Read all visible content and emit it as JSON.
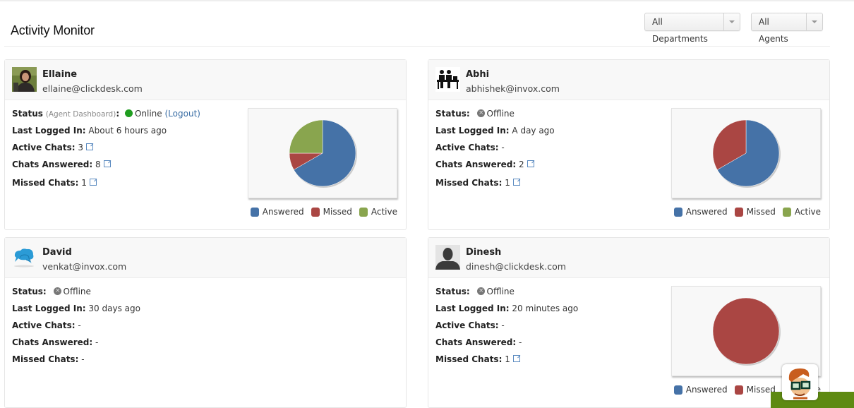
{
  "page": {
    "title": "Activity Monitor"
  },
  "filters": {
    "department": {
      "selected": "All Departments"
    },
    "agent": {
      "selected": "All Agents"
    }
  },
  "labels": {
    "status": "Status",
    "status_sub": "(Agent Dashboard)",
    "colon": ":",
    "last_logged_in": "Last Logged In:",
    "active_chats": "Active Chats:",
    "chats_answered": "Chats Answered:",
    "missed_chats": "Missed Chats:",
    "logout": "(Logout)"
  },
  "legend": [
    {
      "label": "Answered",
      "color": "#4572a7"
    },
    {
      "label": "Missed",
      "color": "#aa4643"
    },
    {
      "label": "Active",
      "color": "#89a54e"
    }
  ],
  "agents": [
    {
      "name": "Ellaine",
      "email": "ellaine@clickdesk.com",
      "avatar": "photo",
      "status": "Online",
      "online": true,
      "last_logged_in": "About 6 hours ago",
      "active_chats": "3",
      "chats_answered": "8",
      "missed_chats": "1"
    },
    {
      "name": "Abhi",
      "email": "abhishek@invox.com",
      "avatar": "people-at-desk-icon",
      "status": "Offline",
      "online": false,
      "last_logged_in": "A day ago",
      "active_chats": "-",
      "chats_answered": "2",
      "missed_chats": "1"
    },
    {
      "name": "David",
      "email": "venkat@invox.com",
      "avatar": "chat-bubbles-icon",
      "status": "Offline",
      "online": false,
      "last_logged_in": "30 days ago",
      "active_chats": "-",
      "chats_answered": "-",
      "missed_chats": "-"
    },
    {
      "name": "Dinesh",
      "email": "dinesh@clickdesk.com",
      "avatar": "default-user-silhouette",
      "status": "Offline",
      "online": false,
      "last_logged_in": "20 minutes ago",
      "active_chats": "-",
      "chats_answered": "-",
      "missed_chats": "1"
    }
  ],
  "chart_data": [
    {
      "type": "pie",
      "agent": "Ellaine",
      "categories": [
        "Answered",
        "Missed",
        "Active"
      ],
      "values": [
        8,
        1,
        3
      ]
    },
    {
      "type": "pie",
      "agent": "Abhi",
      "categories": [
        "Answered",
        "Missed",
        "Active"
      ],
      "values": [
        2,
        1,
        0
      ]
    },
    {
      "type": "pie",
      "agent": "Dinesh",
      "categories": [
        "Answered",
        "Missed",
        "Active"
      ],
      "values": [
        0,
        1,
        0
      ]
    }
  ]
}
